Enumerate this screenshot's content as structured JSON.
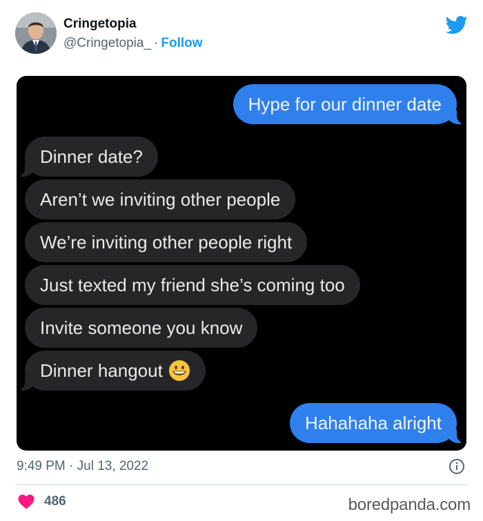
{
  "tweet": {
    "author_name": "Cringetopia",
    "author_handle": "@Cringetopia_",
    "separator": "·",
    "follow_label": "Follow",
    "timestamp": "9:49 PM · Jul 13, 2022",
    "likes_count": "486",
    "brand_color": "#1d9bf0",
    "heart_color": "#f91880"
  },
  "chat": {
    "messages": [
      {
        "direction": "sent",
        "text": "Hype for our dinner date"
      },
      {
        "direction": "received",
        "text": "Dinner date?"
      },
      {
        "direction": "received",
        "text": "Aren’t we inviting other people"
      },
      {
        "direction": "received",
        "text": "We’re inviting other people right"
      },
      {
        "direction": "received",
        "text": "Just texted my friend she’s coming too"
      },
      {
        "direction": "received",
        "text": "Invite someone you know"
      },
      {
        "direction": "received",
        "text": "Dinner hangout",
        "emoji": "grinning-face-icon"
      },
      {
        "direction": "sent",
        "text": "Hahahaha alright"
      }
    ]
  },
  "watermark": "boredpanda.com",
  "icons": [
    "twitter-bird-icon",
    "info-icon",
    "heart-icon",
    "grinning-face-icon"
  ]
}
